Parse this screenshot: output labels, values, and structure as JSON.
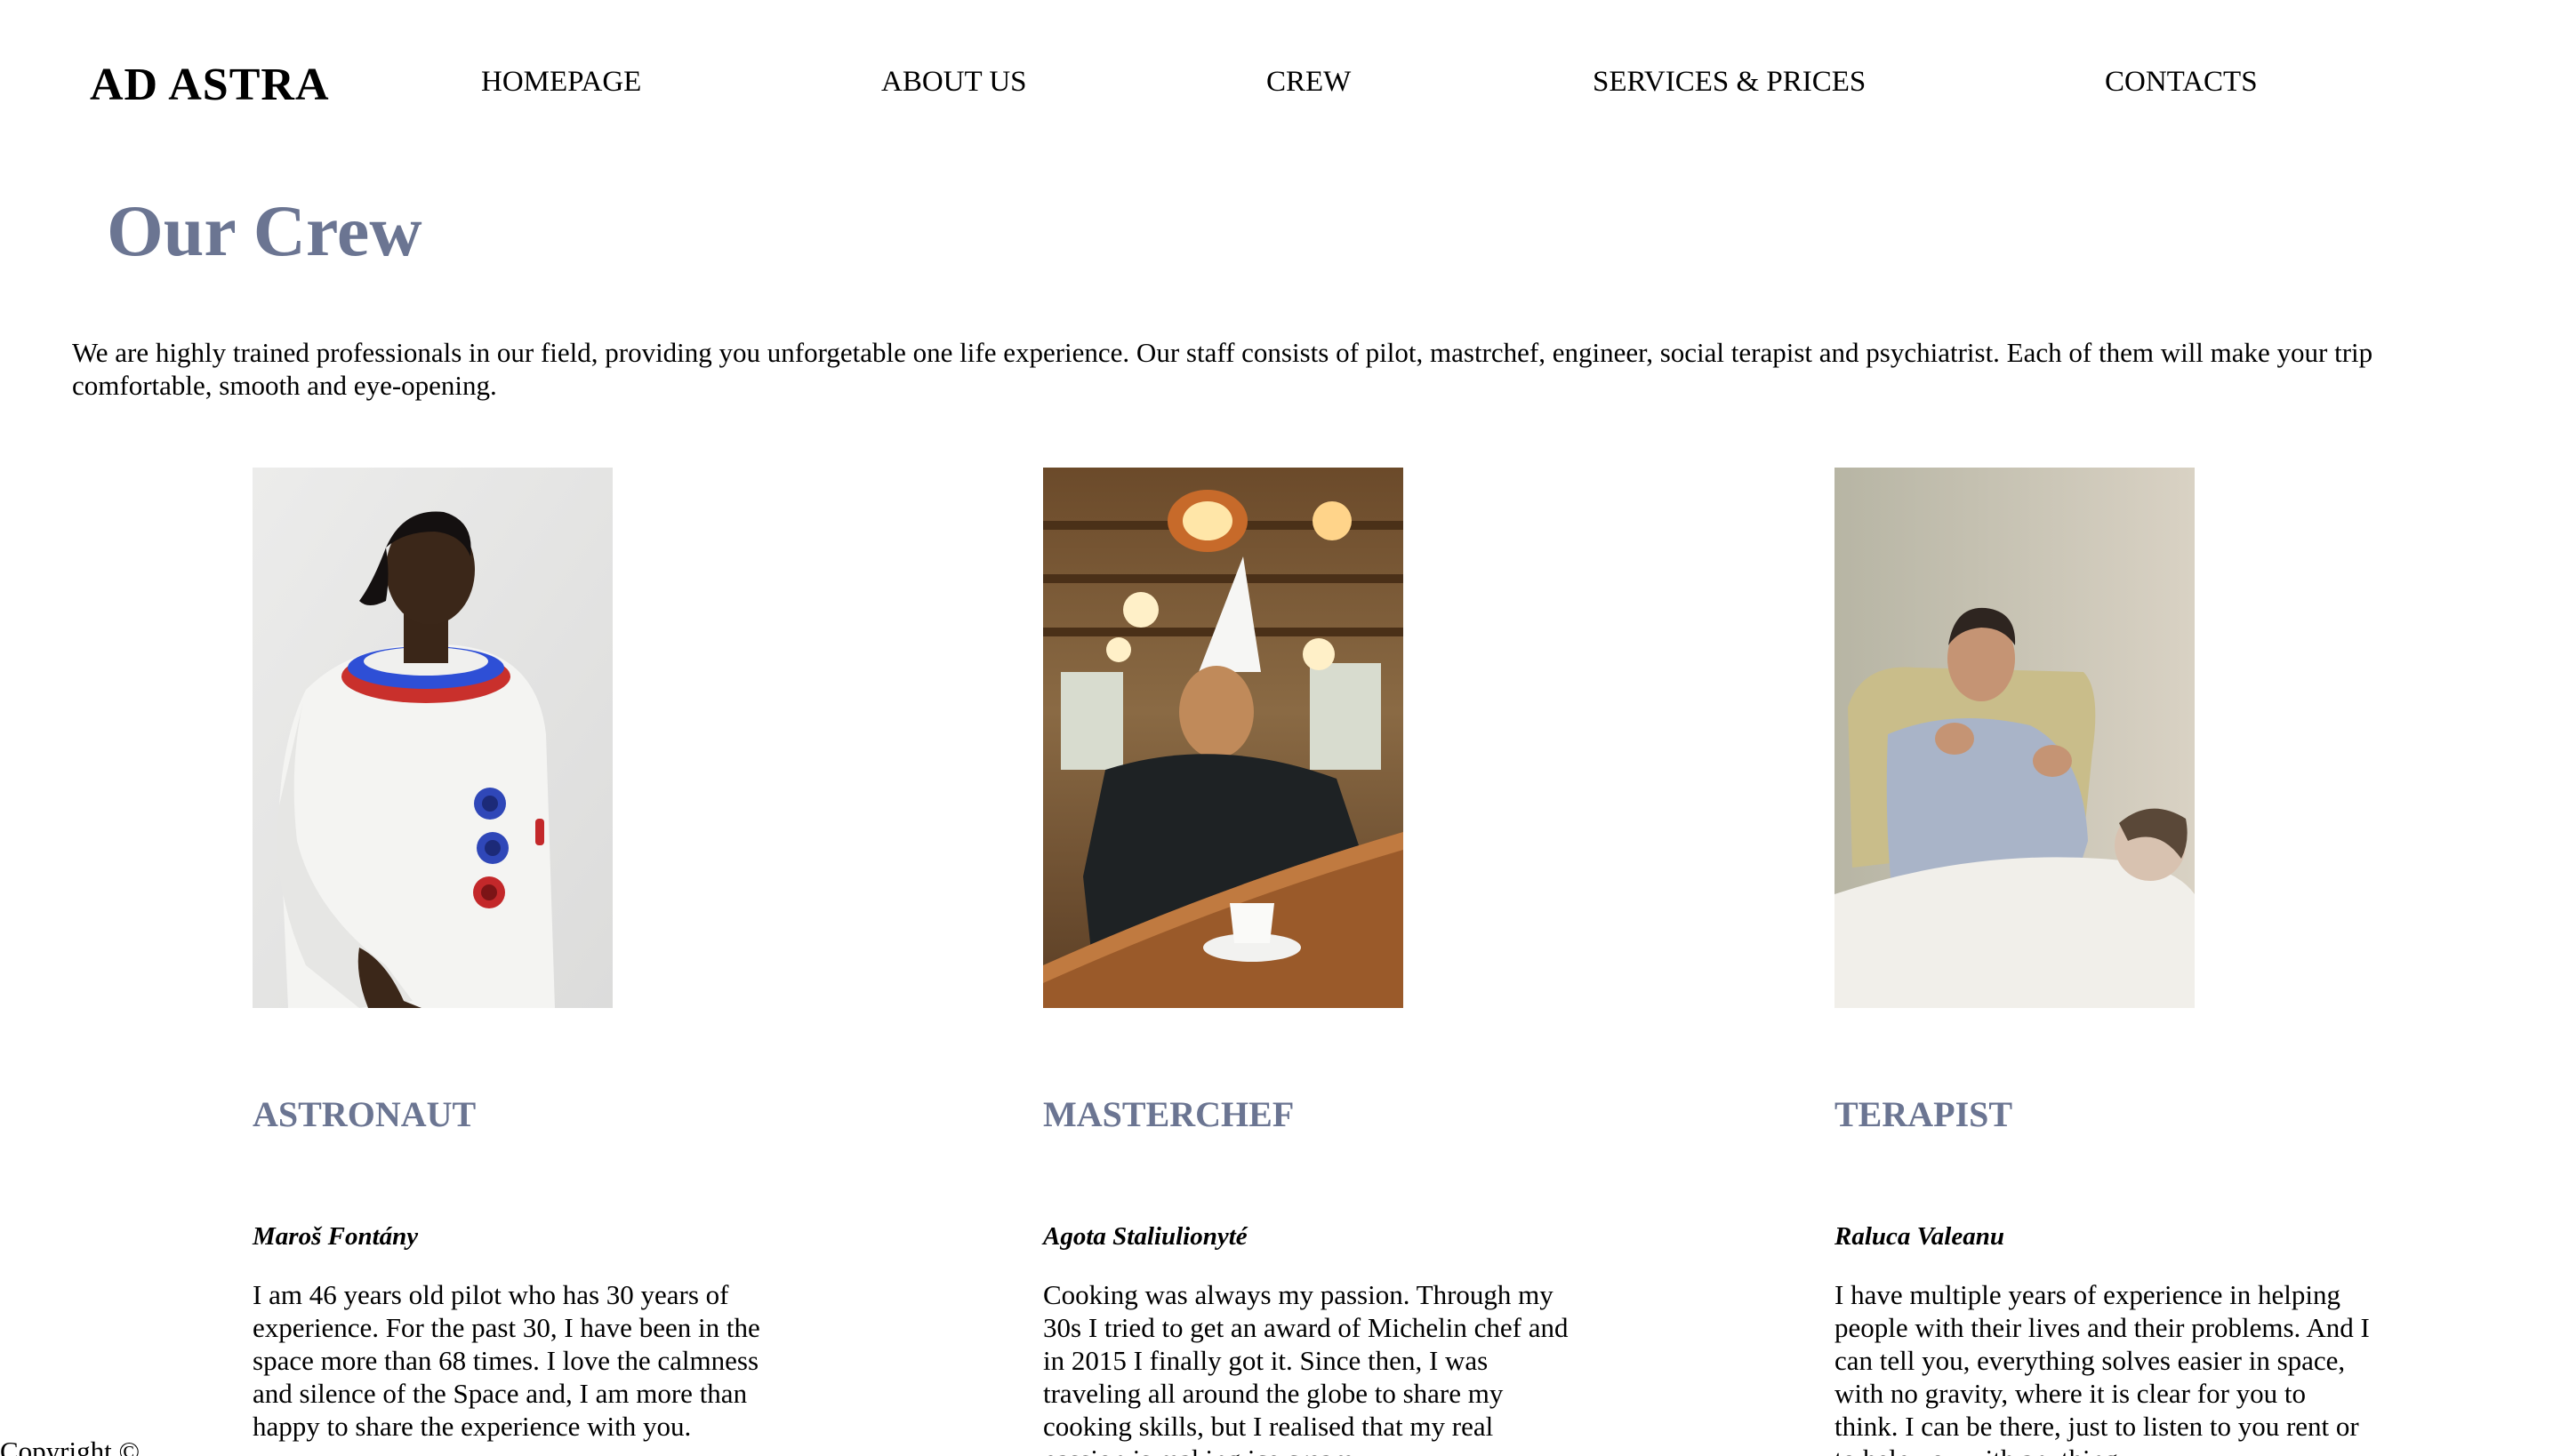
{
  "brand": {
    "name": "AD ASTRA"
  },
  "nav": {
    "items": [
      "HOMEPAGE",
      "ABOUT US",
      "CREW",
      "SERVICES & PRICES",
      "CONTACTS"
    ]
  },
  "page": {
    "title": "Our Crew",
    "intro": "We are highly trained professionals in our field, providing you unforgetable one life experience. Our staff consists of pilot, mastrchef, engineer, social terapist and psychiatrist. Each of them will make your trip comfortable, smooth and eye-opening."
  },
  "crew": [
    {
      "role": "ASTRONAUT",
      "name": "Maroš Fontány",
      "bio": "I am 46 years old pilot who has 30 years of experience. For the past 30, I have been in the space more than 68 times. I love the calmness and silence of the Space and, I am more than happy to share the experience with you."
    },
    {
      "role": "MASTERCHEF",
      "name": "Agota Staliulionyté",
      "bio": "Cooking was always my passion. Through my 30s I tried to get an award of Michelin chef and in 2015 I finally got it. Since then, I was traveling all around the globe to share my cooking skills, but I realised that my real passion is making ice cream."
    },
    {
      "role": "TERAPIST",
      "name": "Raluca Valeanu",
      "bio": "I have multiple years of experience in helping people with their lives and their problems. And I can tell you, everything solves easier in space, with no gravity, where it is clear for you to think. I can be there, just to listen to you rent or to help you with anything."
    }
  ],
  "footer": {
    "text": "Copyright ©"
  },
  "colors": {
    "accent": "#6b7592",
    "text": "#000000",
    "background": "#ffffff"
  },
  "icons": {
    "photo_1": "astronaut-photo",
    "photo_2": "chef-photo",
    "photo_3": "therapist-photo"
  }
}
